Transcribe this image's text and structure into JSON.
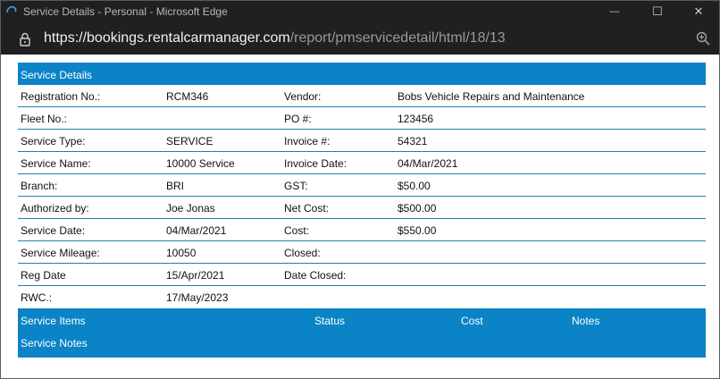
{
  "window": {
    "title": "Service Details - Personal - Microsoft Edge",
    "controls": {
      "minimize": "—",
      "maximize": "☐",
      "close": "✕"
    }
  },
  "address": {
    "url_host": "https://bookings.rentalcarmanager.com",
    "url_path": "/report/pmservicedetail/html/18/13"
  },
  "report": {
    "header": "Service Details",
    "rows": [
      {
        "label1": "Registration No.:",
        "value1": "RCM346",
        "label2": "Vendor:",
        "value2": "Bobs Vehicle Repairs and Maintenance"
      },
      {
        "label1": "Fleet No.:",
        "value1": "",
        "label2": "PO #:",
        "value2": "123456"
      },
      {
        "label1": "Service Type:",
        "value1": "SERVICE",
        "label2": "Invoice #:",
        "value2": "54321"
      },
      {
        "label1": "Service Name:",
        "value1": "10000 Service",
        "label2": "Invoice Date:",
        "value2": "04/Mar/2021"
      },
      {
        "label1": "Branch:",
        "value1": "BRI",
        "label2": "GST:",
        "value2": "$50.00"
      },
      {
        "label1": "Authorized by:",
        "value1": "Joe Jonas",
        "label2": "Net Cost:",
        "value2": "$500.00"
      },
      {
        "label1": "Service Date:",
        "value1": "04/Mar/2021",
        "label2": "Cost:",
        "value2": "$550.00"
      },
      {
        "label1": "Service Mileage:",
        "value1": "10050",
        "label2": "Closed:",
        "value2": ""
      },
      {
        "label1": "Reg Date",
        "value1": "15/Apr/2021",
        "label2": "Date Closed:",
        "value2": ""
      },
      {
        "label1": "RWC.:",
        "value1": "17/May/2023",
        "label2": "",
        "value2": ""
      }
    ],
    "items_header": {
      "col1": "Service Items",
      "col2": "Status",
      "col3": "Cost",
      "col4": "Notes"
    },
    "notes_header": "Service Notes"
  }
}
